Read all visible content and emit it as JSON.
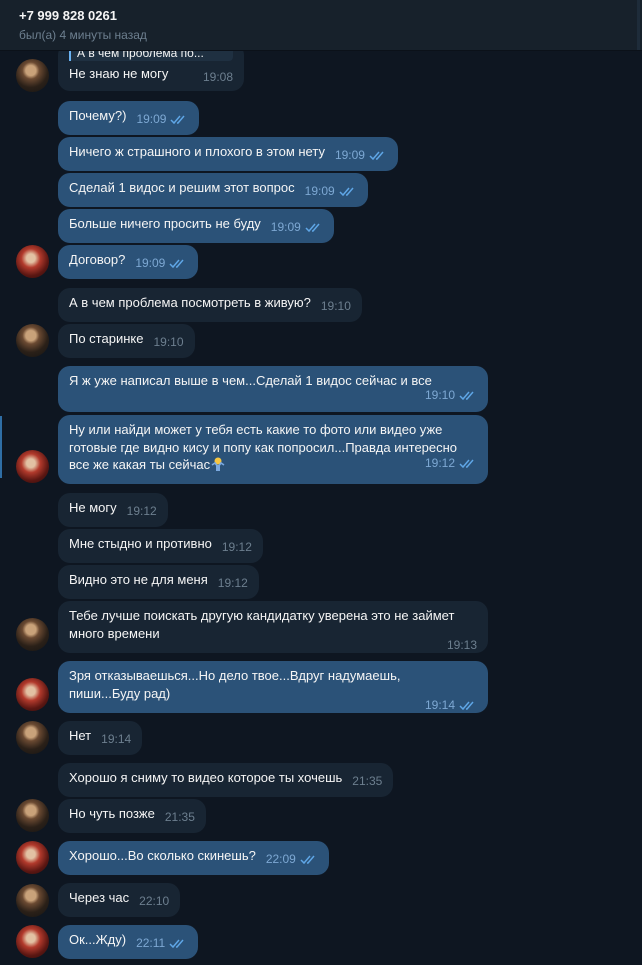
{
  "header": {
    "title": "+7 999 828 0261",
    "status": "был(а) 4 минуты назад"
  },
  "colors": {
    "background": "#0e1621",
    "incoming_bubble": "#182533",
    "outgoing_bubble": "#2b5278",
    "time_in": "#6d7f8f",
    "time_out": "#7da8d3",
    "read_check": "#5fa6e6"
  },
  "messages": [
    {
      "id": "m1",
      "dir": "in",
      "quote": "А в чем проблема по...",
      "text": "Не знаю не могу",
      "time": "19:08"
    },
    {
      "id": "m2",
      "dir": "out",
      "text": "Почему?)",
      "time": "19:09",
      "read": true
    },
    {
      "id": "m3",
      "dir": "out",
      "text": "Ничего ж страшного и плохого в этом нету",
      "time": "19:09",
      "read": true
    },
    {
      "id": "m4",
      "dir": "out",
      "text": "Сделай 1 видос и решим этот вопрос",
      "time": "19:09",
      "read": true
    },
    {
      "id": "m5",
      "dir": "out",
      "text": "Больше ничего просить не буду",
      "time": "19:09",
      "read": true
    },
    {
      "id": "m6",
      "dir": "out",
      "text": "Договор?",
      "time": "19:09",
      "read": true
    },
    {
      "id": "m7",
      "dir": "in",
      "text": "А в чем проблема посмотреть в живую?",
      "time": "19:10"
    },
    {
      "id": "m8",
      "dir": "in",
      "text": "По старинке",
      "time": "19:10"
    },
    {
      "id": "m9",
      "dir": "out",
      "text": "Я ж уже написал выше в чем...Сделай 1 видос сейчас и все",
      "time": "19:10",
      "read": true
    },
    {
      "id": "m10",
      "dir": "out",
      "text": "Ну или найди может у тебя есть какие то фото или видео уже\nготовые где видно кису и попу как попросил...Правда интересно\nвсе же какая ты сейчас",
      "emoji": "person-shrugging-emoji",
      "time": "19:12",
      "read": true
    },
    {
      "id": "m11",
      "dir": "in",
      "text": "Не могу",
      "time": "19:12"
    },
    {
      "id": "m12",
      "dir": "in",
      "text": "Мне стыдно и противно",
      "time": "19:12"
    },
    {
      "id": "m13",
      "dir": "in",
      "text": "Видно это не для меня",
      "time": "19:12"
    },
    {
      "id": "m14",
      "dir": "in",
      "text": "Тебе лучше поискать другую кандидатку уверена это не займет\nмного времени",
      "time": "19:13"
    },
    {
      "id": "m15",
      "dir": "out",
      "text": "Зря отказываешься...Но дело твое...Вдруг надумаешь,\nпиши...Буду рад)",
      "time": "19:14",
      "read": true
    },
    {
      "id": "m16",
      "dir": "in",
      "text": "Нет",
      "time": "19:14"
    },
    {
      "id": "m17",
      "dir": "in",
      "text": "Хорошо я сниму то видео которое ты хочешь",
      "time": "21:35"
    },
    {
      "id": "m18",
      "dir": "in",
      "text": "Но чуть позже",
      "time": "21:35"
    },
    {
      "id": "m19",
      "dir": "out",
      "text": "Хорошо...Во сколько скинешь?",
      "time": "22:09",
      "read": true
    },
    {
      "id": "m20",
      "dir": "in",
      "text": "Через час",
      "time": "22:10"
    },
    {
      "id": "m21",
      "dir": "out",
      "text": "Ок...Жду)",
      "time": "22:11",
      "read": true
    }
  ]
}
